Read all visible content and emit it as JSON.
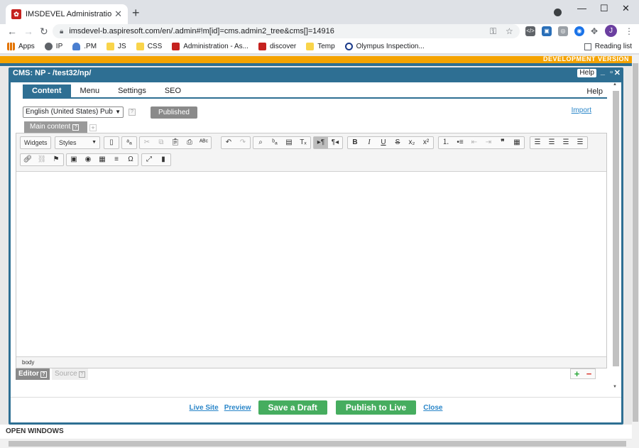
{
  "browser": {
    "tab_title": "IMSDEVEL Administration - Aspire",
    "url": "imsdevel-b.aspiresoft.com/en/.admin#!m[id]=cms.admin2_tree&cms[]=14916",
    "bookmarks": [
      {
        "label": "Apps",
        "icon": "apps-icon"
      },
      {
        "label": "IP",
        "icon": "globe-icon"
      },
      {
        "label": ".PM",
        "icon": "person-icon"
      },
      {
        "label": "JS",
        "icon": "folder-icon"
      },
      {
        "label": "CSS",
        "icon": "folder-icon"
      },
      {
        "label": "Administration - As...",
        "icon": "aspire-icon"
      },
      {
        "label": "discover",
        "icon": "aspire-icon"
      },
      {
        "label": "Temp",
        "icon": "folder-icon"
      },
      {
        "label": "Olympus Inspection...",
        "icon": "olympus-icon"
      }
    ],
    "reading_list": "Reading list",
    "avatar_letter": "J"
  },
  "page": {
    "dev_banner": "DEVELOPMENT VERSION",
    "dialog": {
      "title": "CMS: NP - /test32/np/",
      "help": "Help",
      "tabs": [
        "Content",
        "Menu",
        "Settings",
        "SEO"
      ],
      "help_link": "Help",
      "language": "English (United States) Pub",
      "published_btn": "Published",
      "import_link": "Import",
      "main_content_tab": "Main content",
      "editor": {
        "widgets": "Widgets",
        "styles": "Styles",
        "footer_path": "body"
      },
      "mode_editor": "Editor",
      "mode_source": "Source",
      "actions": {
        "live_site": "Live Site",
        "preview": "Preview",
        "save_draft": "Save a Draft",
        "publish": "Publish to Live",
        "close": "Close"
      }
    },
    "open_windows": "OPEN WINDOWS"
  },
  "colors": {
    "accent": "#2e6f93",
    "dev_banner": "#f5a300",
    "action_green": "#46ad5f",
    "link": "#2a86c9"
  }
}
